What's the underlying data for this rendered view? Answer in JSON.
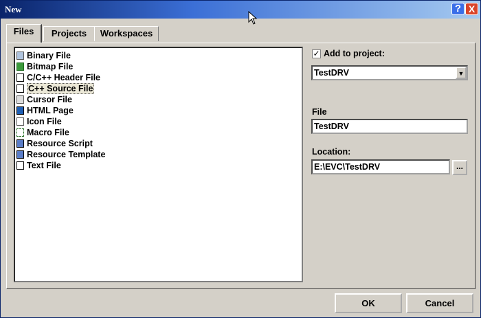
{
  "window": {
    "title": "New",
    "help_glyph": "?",
    "close_glyph": "X"
  },
  "tabs": [
    {
      "label": "Files",
      "active": true
    },
    {
      "label": "Projects",
      "active": false
    },
    {
      "label": "Workspaces",
      "active": false
    }
  ],
  "files": [
    {
      "label": "Binary File",
      "icon": "binary-file-icon"
    },
    {
      "label": "Bitmap File",
      "icon": "bitmap-file-icon"
    },
    {
      "label": "C/C++ Header File",
      "icon": "header-file-icon"
    },
    {
      "label": "C++ Source File",
      "icon": "source-file-icon",
      "selected": true
    },
    {
      "label": "Cursor File",
      "icon": "cursor-file-icon"
    },
    {
      "label": "HTML Page",
      "icon": "html-page-icon"
    },
    {
      "label": "Icon File",
      "icon": "icon-file-icon"
    },
    {
      "label": "Macro File",
      "icon": "macro-file-icon"
    },
    {
      "label": "Resource Script",
      "icon": "resource-script-icon"
    },
    {
      "label": "Resource Template",
      "icon": "resource-template-icon"
    },
    {
      "label": "Text File",
      "icon": "text-file-icon"
    }
  ],
  "options": {
    "add_to_project_label": "Add to project:",
    "add_to_project_checked": true,
    "check_glyph": "✓",
    "project_value": "TestDRV",
    "file_label": "File",
    "file_value": "TestDRV",
    "location_label": "Location:",
    "location_value": "E:\\EVC\\TestDRV",
    "browse_label": "..."
  },
  "buttons": {
    "ok": "OK",
    "cancel": "Cancel"
  },
  "colors": {
    "title_start": "#0a246a",
    "title_end": "#a6caf0",
    "face": "#d4d0c8"
  }
}
